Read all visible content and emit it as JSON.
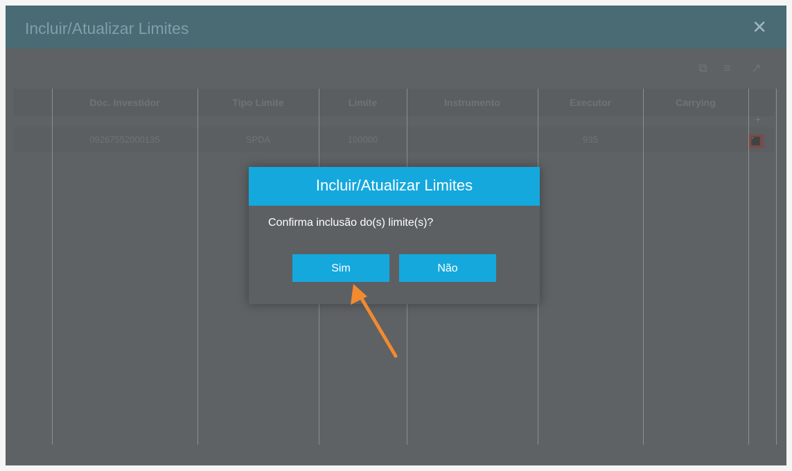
{
  "window": {
    "title": "Incluir/Atualizar Limites",
    "close_glyph": "✕"
  },
  "toolbar": {
    "icons": [
      "export-icon",
      "filter-icon",
      "expand-icon"
    ],
    "glyphs": [
      "⧉",
      "≡",
      "↗"
    ]
  },
  "table": {
    "columns": [
      "Doc. Investidor",
      "Tipo Limite",
      "Limite",
      "Instrumento",
      "Executor",
      "Carrying"
    ],
    "rows": [
      [
        "09267552000135",
        "SPDA",
        "100000",
        "",
        "935",
        ""
      ]
    ],
    "add_glyph": "+",
    "delete_glyph": "⬛"
  },
  "dialog": {
    "title": "Incluir/Atualizar Limites",
    "message": "Confirma inclusão do(s) limite(s)?",
    "yes_label": "Sim",
    "no_label": "Não"
  },
  "colors": {
    "accent": "#15a8dd",
    "annotation_arrow": "#f28a30"
  }
}
